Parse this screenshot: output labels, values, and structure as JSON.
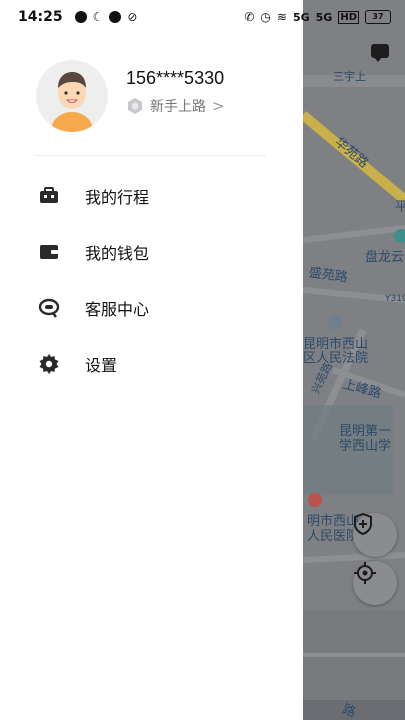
{
  "status_bar": {
    "time": "14:25",
    "signal_1": "5G",
    "signal_2": "5G",
    "battery": "37"
  },
  "profile": {
    "phone": "156****5330",
    "level": "新手上路"
  },
  "menu": [
    {
      "label": "我的行程",
      "icon": "briefcase-icon"
    },
    {
      "label": "我的钱包",
      "icon": "wallet-icon"
    },
    {
      "label": "客服中心",
      "icon": "headset-icon"
    },
    {
      "label": "设置",
      "icon": "gear-icon"
    }
  ],
  "map": {
    "labels": [
      "华苑路",
      "盘龙云",
      "盛苑路",
      "Y310",
      "昆明市西山",
      "区人民法院",
      "兴苑路",
      "上峰路",
      "昆明第一",
      "学西山学",
      "明市西山",
      "人民医院",
      "三宇上",
      "平",
      "路"
    ]
  },
  "colors": {
    "map_dim": "#7f8084",
    "road_yellow": "#c9b04a"
  }
}
